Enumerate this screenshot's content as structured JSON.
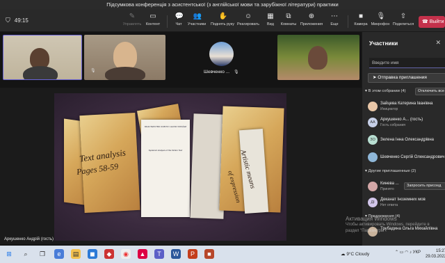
{
  "window": {
    "title": "Підсумкова конференція з асистентської (з англійської мови та зарубіжної літератури) практики"
  },
  "toolbar": {
    "timer": "49:15",
    "buttons": [
      {
        "label": "Управлять",
        "icon": "pen-icon"
      },
      {
        "label": "Контент",
        "icon": "share-screen-icon"
      },
      {
        "label": "Чат",
        "icon": "chat-icon"
      },
      {
        "label": "Участники",
        "icon": "people-icon",
        "badge": "4"
      },
      {
        "label": "Поднять руку",
        "icon": "hand-icon"
      },
      {
        "label": "Реагировать",
        "icon": "smile-icon"
      },
      {
        "label": "Вид",
        "icon": "grid-icon"
      },
      {
        "label": "Комнаты",
        "icon": "rooms-icon"
      },
      {
        "label": "Приложения",
        "icon": "plus-icon"
      },
      {
        "label": "Еще",
        "icon": "more-icon"
      },
      {
        "label": "Камера",
        "icon": "camera-icon"
      },
      {
        "label": "Микрофон",
        "icon": "mic-icon"
      },
      {
        "label": "Поделиться",
        "icon": "upload-icon"
      }
    ],
    "leave_label": "Выйти"
  },
  "tiles": {
    "center_name": "Шевченко ...",
    "presenter_name": "Аркушенко Андрій (гость)"
  },
  "slide": {
    "left_title": "Text analysis",
    "left_pages": "Pages 58-59",
    "right_title": "Artistic means",
    "right_sub": "of expression",
    "header_lines": "МІНІСТЕРСТВО ОСВІТИ І НАУКИ УКРАЇНИ",
    "page_title": "Systemic Analysis of the Fiction Text"
  },
  "panel": {
    "title": "Участники",
    "search_placeholder": "Введите имя",
    "invite_label": "Отправка приглашения",
    "in_meeting_label": "В этом собрании (4)",
    "mute_all_label": "Отключить все",
    "others_label": "Другие приглашенные (2)",
    "suggested_label": "Предложения (4)",
    "request_label": "Запросить присоед",
    "participants": [
      {
        "name": "Зайцева Катерина Іванівна",
        "role": "Инициатор",
        "initials": "",
        "color": "#e9c7a8"
      },
      {
        "name": "Аркушенко А... (гость)",
        "role": "Гость собрания",
        "initials": "АА",
        "color": "#c7d0e8"
      },
      {
        "name": "Зелена Інна Олександрівна",
        "role": "",
        "initials": "ЗО",
        "color": "#b8dfd2"
      },
      {
        "name": "Шевченко Сергій Олександрович",
        "role": "",
        "initials": "",
        "color": "#8fb7d8"
      }
    ],
    "others": [
      {
        "name": "Кинева ...",
        "role": "Принято",
        "initials": "",
        "color": "#d3a7a7"
      },
      {
        "name": "Деканат Іноземних мов",
        "role": "Нет ответа",
        "initials": "ДІ",
        "color": "#d2c6ea"
      }
    ],
    "suggested": [
      {
        "name": "Трубадина Ольга Михайлівна",
        "role": "",
        "initials": "",
        "color": "#c9b39c"
      }
    ]
  },
  "watermark": {
    "title": "Активация Windows",
    "text": "Чтобы активировать Windows, перейдите в раздел \"Параметры\"."
  },
  "taskbar": {
    "weather": "9°C Cloudy",
    "lang": "УКР",
    "time": "15:27",
    "date": "29.03.2022"
  }
}
